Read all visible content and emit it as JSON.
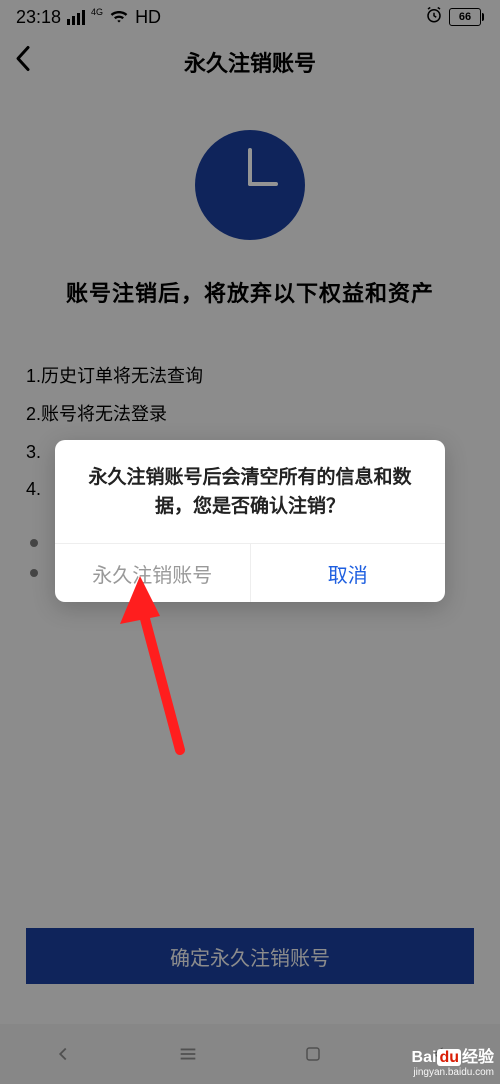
{
  "status": {
    "time": "23:18",
    "net_badge": "4G",
    "hd": "HD",
    "battery": "66"
  },
  "header": {
    "title": "永久注销账号"
  },
  "page": {
    "heading": "账号注销后，将放弃以下权益和资产",
    "items": [
      "1.历史订单将无法查询",
      "2.账号将无法登录",
      "3.",
      "4."
    ],
    "confirm_btn": "确定永久注销账号"
  },
  "dialog": {
    "message": "永久注销账号后会清空所有的信息和数据，您是否确认注销？",
    "confirm": "永久注销账号",
    "cancel": "取消"
  },
  "watermark": {
    "brand_bai": "Bai",
    "brand_du": "du",
    "brand_suffix": "经验",
    "url": "jingyan.baidu.com"
  }
}
